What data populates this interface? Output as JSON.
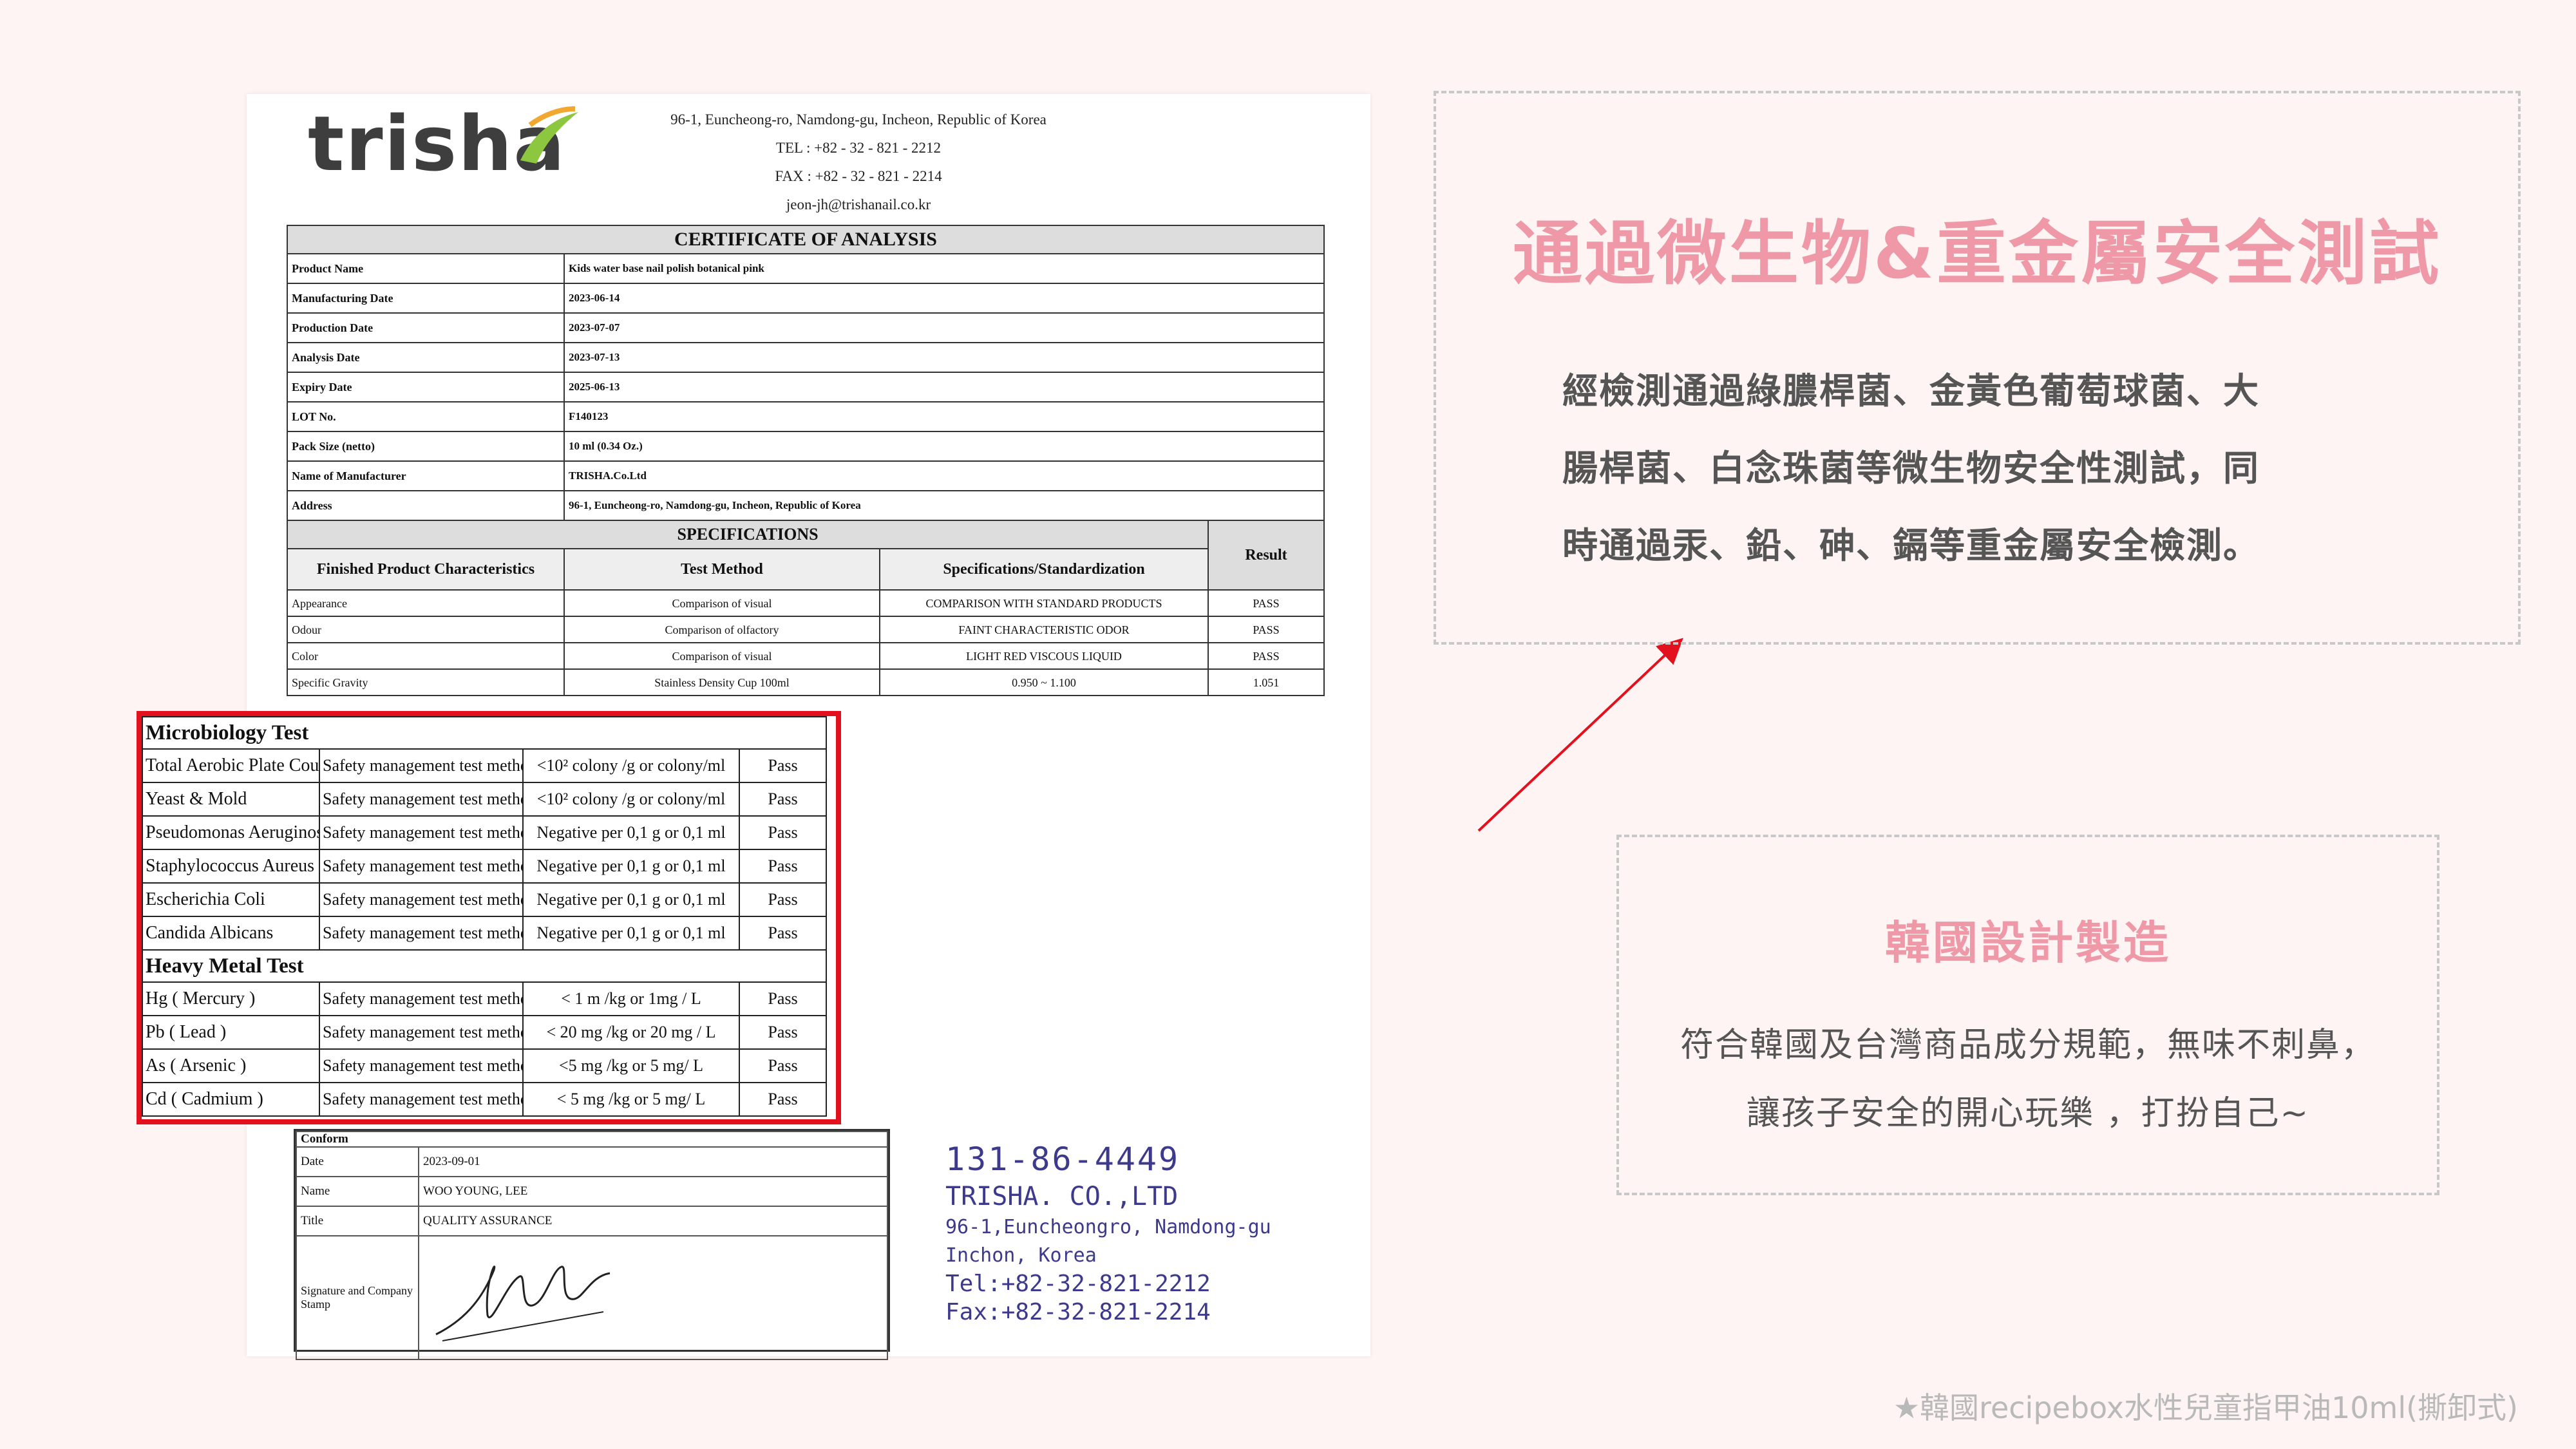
{
  "certificate": {
    "logo_text": "trisha",
    "address_lines": [
      "96-1, Euncheong-ro, Namdong-gu, Incheon, Republic of Korea",
      "TEL : +82 - 32 - 821 - 2212",
      "FAX : +82 - 32 - 821 - 2214",
      "jeon-jh@trishanail.co.kr"
    ],
    "title": "CERTIFICATE OF ANALYSIS",
    "info_rows": [
      {
        "label": "Product Name",
        "value": "Kids water base nail polish botanical pink"
      },
      {
        "label": "Manufacturing Date",
        "value": "2023-06-14"
      },
      {
        "label": "Production Date",
        "value": "2023-07-07"
      },
      {
        "label": "Analysis Date",
        "value": "2023-07-13"
      },
      {
        "label": "Expiry Date",
        "value": "2025-06-13"
      },
      {
        "label": "LOT No.",
        "value": "F140123"
      },
      {
        "label": "Pack Size (netto)",
        "value": "10 ml (0.34 Oz.)"
      },
      {
        "label": "Name of Manufacturer",
        "value": "TRISHA.Co.Ltd"
      },
      {
        "label": "Address",
        "value": "96-1, Euncheong-ro, Namdong-gu, Incheon, Republic of Korea"
      }
    ],
    "specifications_header": "SPECIFICATIONS",
    "result_header": "Result",
    "columns": [
      "Finished Product Characteristics",
      "Test Method",
      "Specifications/Standardization"
    ],
    "spec_rows": [
      {
        "item": "Appearance",
        "method": "Comparison of visual",
        "spec": "COMPARISON WITH STANDARD PRODUCTS",
        "result": "PASS"
      },
      {
        "item": "Odour",
        "method": "Comparison of olfactory",
        "spec": "FAINT CHARACTERISTIC ODOR",
        "result": "PASS"
      },
      {
        "item": "Color",
        "method": "Comparison of visual",
        "spec": "LIGHT RED VISCOUS LIQUID",
        "result": "PASS"
      },
      {
        "item": "Specific Gravity",
        "method": "Stainless Density Cup 100ml",
        "spec": "0.950 ~ 1.100",
        "result": "1.051"
      }
    ],
    "conform_label": "Conform",
    "signoff_rows": [
      {
        "label": "Date",
        "value": "2023-09-01"
      },
      {
        "label": "Name",
        "value": "WOO YOUNG, LEE"
      },
      {
        "label": "Title",
        "value": "QUALITY ASSURANCE"
      }
    ],
    "signature_label": "Signature and Company Stamp",
    "stamp_lines": [
      "131-86-4449",
      "TRISHA. CO.,LTD",
      "96-1,Euncheongro, Namdong-gu",
      "Inchon, Korea",
      "Tel:+82-32-821-2212",
      "Fax:+82-32-821-2214"
    ]
  },
  "highlight": {
    "microbiology_title": "Microbiology Test",
    "micro_rows": [
      {
        "item": "Total Aerobic Plate Count",
        "method": "Safety management test method",
        "spec": "<10² colony /g  or colony/ml",
        "result": "Pass"
      },
      {
        "item": "Yeast & Mold",
        "method": "Safety management test method",
        "spec": "<10² colony /g  or colony/ml",
        "result": "Pass"
      },
      {
        "item": "Pseudomonas Aeruginosa",
        "method": "Safety management test method",
        "spec": "Negative per 0,1 g  or 0,1 ml",
        "result": "Pass"
      },
      {
        "item": "Staphylococcus Aureus",
        "method": "Safety management test method",
        "spec": "Negative per 0,1 g  or 0,1 ml",
        "result": "Pass"
      },
      {
        "item": "Escherichia Coli",
        "method": "Safety management test method",
        "spec": "Negative per 0,1 g  or 0,1 ml",
        "result": "Pass"
      },
      {
        "item": "Candida Albicans",
        "method": "Safety management test method",
        "spec": "Negative per 0,1 g  or 0,1 ml",
        "result": "Pass"
      }
    ],
    "heavy_title": "Heavy Metal Test",
    "heavy_rows": [
      {
        "item": "Hg ( Mercury )",
        "method": "Safety management test method",
        "spec": "< 1 m /kg or 1mg / L",
        "result": "Pass"
      },
      {
        "item": "Pb ( Lead )",
        "method": "Safety management test method",
        "spec": "< 20 mg /kg  or 20 mg / L",
        "result": "Pass"
      },
      {
        "item": "As ( Arsenic )",
        "method": "Safety management test method",
        "spec": "<5 mg /kg  or  5 mg/ L",
        "result": "Pass"
      },
      {
        "item": "Cd ( Cadmium )",
        "method": "Safety management test method",
        "spec": "< 5 mg /kg  or  5 mg/ L",
        "result": "Pass"
      }
    ]
  },
  "panel_top": {
    "title": "通過微生物&重金屬安全測試",
    "body_lines": [
      "經檢測通過綠膿桿菌、金黃色葡萄球菌、大",
      "腸桿菌、白念珠菌等微生物安全性測試，同",
      "時通過汞、鉛、砷、鎘等重金屬安全檢測。"
    ]
  },
  "panel_bottom": {
    "title": "韓國設計製造",
    "body_lines": [
      "符合韓國及台灣商品成分規範，無味不刺鼻，",
      "讓孩子安全的開心玩樂 ，打扮自己~"
    ]
  },
  "footer": "★韓國recipebox水性兒童指甲油10ml(撕卸式)",
  "colors": {
    "accent_pink": "#ee98a8",
    "highlight_red": "#e3101e",
    "stamp_blue": "#3d3a8c",
    "background": "#fdf4f3"
  }
}
